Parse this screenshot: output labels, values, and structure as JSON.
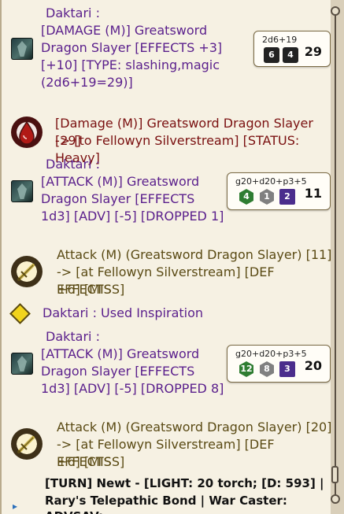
{
  "log": {
    "entry1": {
      "speaker": "Daktari :",
      "lines": [
        "[DAMAGE (M)] Greatsword",
        "Dragon Slayer [EFFECTS +3]",
        "[+10] [TYPE: slashing,magic",
        "(2d6+19=29)]"
      ],
      "roll": {
        "formula": "2d6+19",
        "dice": [
          "6",
          "4"
        ],
        "total": "29"
      }
    },
    "entry2": {
      "lines": [
        "[Damage (M)] Greatsword Dragon Slayer [29]",
        "-> [to Fellowyn Silverstream] [STATUS: Heavy]"
      ]
    },
    "entry3": {
      "speaker": "Daktari :",
      "lines": [
        "[ATTACK (M)] Greatsword",
        "Dragon Slayer [EFFECTS",
        "1d3] [ADV] [-5] [DROPPED 1]"
      ],
      "roll": {
        "formula": "g20+d20+p3+5",
        "dice": [
          "4",
          "1",
          "2"
        ],
        "total": "11"
      }
    },
    "entry4": {
      "lines": [
        "Attack (M) (Greatsword Dragon Slayer) [11]",
        "-> [at Fellowyn Silverstream] [DEF EFFECTS",
        "+6] [MISS]"
      ]
    },
    "entry5": {
      "text": "Daktari :  Used Inspiration"
    },
    "entry6": {
      "speaker": "Daktari :",
      "lines": [
        "[ATTACK (M)] Greatsword",
        "Dragon Slayer [EFFECTS",
        "1d3] [ADV] [-5] [DROPPED 8]"
      ],
      "roll": {
        "formula": "g20+d20+p3+5",
        "dice": [
          "12",
          "8",
          "3"
        ],
        "total": "20"
      }
    },
    "entry7": {
      "lines": [
        "Attack (M) (Greatsword Dragon Slayer) [20]",
        "-> [at Fellowyn Silverstream] [DEF EFFECTS",
        "+6] [MISS]"
      ]
    },
    "turn": {
      "lines": [
        "[TURN] Newt - [LIGHT: 20 torch; [D: 593] |",
        "Rary's Telepathic Bond | War Caster: ADVSAV;"
      ]
    }
  },
  "colors": {
    "speaker": "#5a1f8c",
    "damage": "#7a1010",
    "attack": "#5a4a14",
    "panel": "#f6f1e3"
  },
  "icons": [
    "character-avatar",
    "blood-drop-icon",
    "sword-icon",
    "inspiration-diamond-icon"
  ]
}
